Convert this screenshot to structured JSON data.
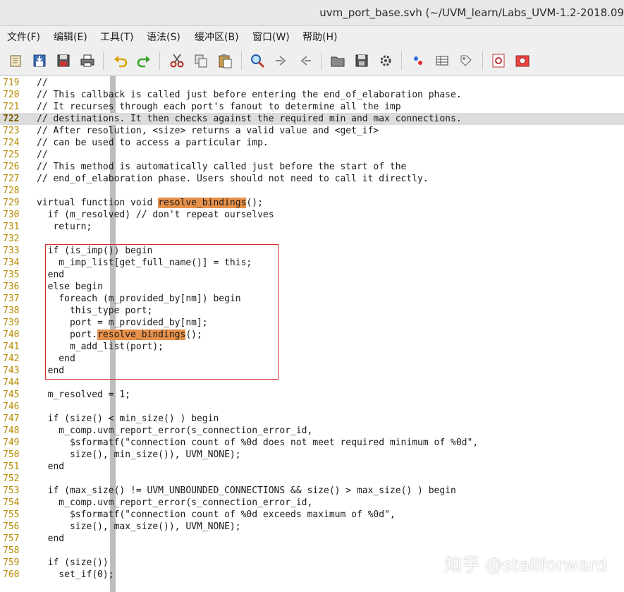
{
  "window": {
    "title": "uvm_port_base.svh (~/UVM_learn/Labs_UVM-1.2-2018.09"
  },
  "menu": [
    {
      "label": "文件(F)"
    },
    {
      "label": "编辑(E)"
    },
    {
      "label": "工具(T)"
    },
    {
      "label": "语法(S)"
    },
    {
      "label": "缓冲区(B)"
    },
    {
      "label": "窗口(W)"
    },
    {
      "label": "帮助(H)"
    }
  ],
  "toolbar": [
    {
      "icon": "open-file-icon"
    },
    {
      "icon": "save-download-icon"
    },
    {
      "icon": "save-all-icon"
    },
    {
      "icon": "print-icon"
    },
    {
      "icon": "undo-icon"
    },
    {
      "icon": "redo-icon"
    },
    {
      "icon": "cut-icon"
    },
    {
      "icon": "copy-icon"
    },
    {
      "icon": "paste-icon"
    },
    {
      "icon": "find-replace-icon"
    },
    {
      "icon": "find-next-icon"
    },
    {
      "icon": "find-prev-icon"
    },
    {
      "icon": "load-session-icon"
    },
    {
      "icon": "save-session-icon"
    },
    {
      "icon": "run-script-icon"
    },
    {
      "icon": "make-icon"
    },
    {
      "icon": "shell-icon"
    },
    {
      "icon": "ctags-icon"
    },
    {
      "icon": "help-icon"
    },
    {
      "icon": "find-help-icon"
    }
  ],
  "code": [
    {
      "n": "719",
      "t": "//"
    },
    {
      "n": "720",
      "t": "// This callback is called just before entering the end_of_elaboration phase."
    },
    {
      "n": "721",
      "t": "// It recurses through each port's fanout to determine all the imp"
    },
    {
      "n": "722",
      "t": "// destinations. It then checks against the required min and max connections."
    },
    {
      "n": "723",
      "t": "// After resolution, <size> returns a valid value and <get_if>"
    },
    {
      "n": "724",
      "t": "// can be used to access a particular imp."
    },
    {
      "n": "725",
      "t": "//"
    },
    {
      "n": "726",
      "t": "// This method is automatically called just before the start of the"
    },
    {
      "n": "727",
      "t": "// end_of_elaboration phase. Users should not need to call it directly."
    },
    {
      "n": "728",
      "t": ""
    },
    {
      "n": "729",
      "t": "virtual function void ",
      "hl": "resolve_bindings",
      "rest": "();"
    },
    {
      "n": "730",
      "t": "  if (m_resolved) // don't repeat ourselves"
    },
    {
      "n": "731",
      "t": "   return;"
    },
    {
      "n": "732",
      "t": ""
    },
    {
      "n": "733",
      "t": "  if (is_imp()) begin"
    },
    {
      "n": "734",
      "t": "    m_imp_list[get_full_name()] = this;"
    },
    {
      "n": "735",
      "t": "  end"
    },
    {
      "n": "736",
      "t": "  else begin"
    },
    {
      "n": "737",
      "t": "    foreach (m_provided_by[nm]) begin"
    },
    {
      "n": "738",
      "t": "      this_type port;"
    },
    {
      "n": "739",
      "t": "      port = m_provided_by[nm];"
    },
    {
      "n": "740",
      "t": "      port.",
      "hl": "resolve_bindings",
      "rest": "();"
    },
    {
      "n": "741",
      "t": "      m_add_list(port);"
    },
    {
      "n": "742",
      "t": "    end"
    },
    {
      "n": "743",
      "t": "  end"
    },
    {
      "n": "744",
      "t": ""
    },
    {
      "n": "745",
      "t": "  m_resolved = 1;"
    },
    {
      "n": "746",
      "t": ""
    },
    {
      "n": "747",
      "t": "  if (size() < min_size() ) begin"
    },
    {
      "n": "748",
      "t": "    m_comp.uvm_report_error(s_connection_error_id,"
    },
    {
      "n": "749",
      "t": "      $sformatf(\"connection count of %0d does not meet required minimum of %0d\","
    },
    {
      "n": "750",
      "t": "      size(), min_size()), UVM_NONE);"
    },
    {
      "n": "751",
      "t": "  end"
    },
    {
      "n": "752",
      "t": ""
    },
    {
      "n": "753",
      "t": "  if (max_size() != UVM_UNBOUNDED_CONNECTIONS && size() > max_size() ) begin"
    },
    {
      "n": "754",
      "t": "    m_comp.uvm_report_error(s_connection_error_id,"
    },
    {
      "n": "755",
      "t": "      $sformatf(\"connection count of %0d exceeds maximum of %0d\","
    },
    {
      "n": "756",
      "t": "      size(), max_size()), UVM_NONE);"
    },
    {
      "n": "757",
      "t": "  end"
    },
    {
      "n": "758",
      "t": ""
    },
    {
      "n": "759",
      "t": "  if (size())"
    },
    {
      "n": "760",
      "t": "    set_if(0);"
    }
  ],
  "current_line": "722",
  "watermark": "知乎 @stallforward",
  "colors": {
    "line_number": "#b58b00",
    "search_highlight": "#e8914a",
    "annotation_box": "#d82c2c",
    "current_line": "#dcdcdc"
  }
}
